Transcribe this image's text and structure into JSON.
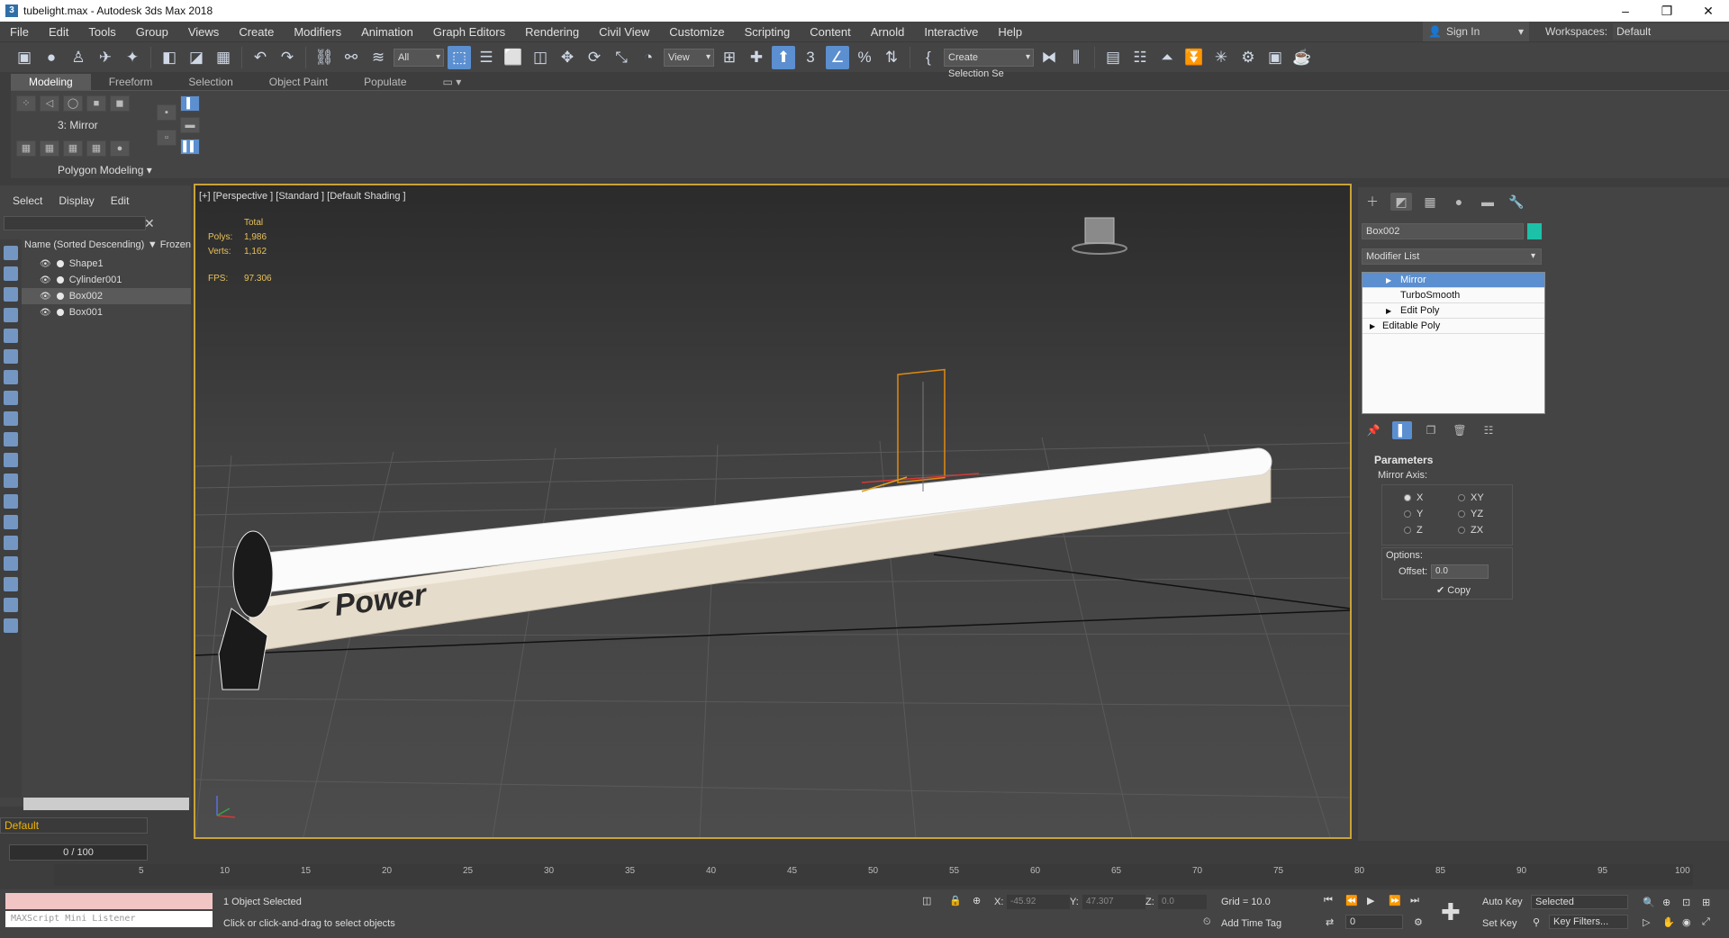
{
  "window": {
    "title": "tubelight.max - Autodesk 3ds Max 2018",
    "app_icon": "3",
    "minimize_glyph": "–",
    "restore_glyph": "❐",
    "close_glyph": "✕"
  },
  "menus": [
    "File",
    "Edit",
    "Tools",
    "Group",
    "Views",
    "Create",
    "Modifiers",
    "Animation",
    "Graph Editors",
    "Rendering",
    "Civil View",
    "Customize",
    "Scripting",
    "Content",
    "Arnold",
    "Interactive",
    "Help"
  ],
  "account": {
    "sign_in": "Sign In",
    "workspaces_label": "Workspaces:",
    "workspace_value": "Default"
  },
  "toolbar": {
    "filter_select": "All",
    "view_select": "View",
    "selection_set": "Create Selection Se",
    "icons": [
      "undo-icon",
      "redo-icon",
      "link-icon",
      "unlink-icon",
      "bind-spacewarp-icon"
    ]
  },
  "ribbon": {
    "tabs": [
      "Modeling",
      "Freeform",
      "Selection",
      "Object Paint",
      "Populate"
    ],
    "active_tab": "Modeling",
    "modifier_label": "3: Mirror",
    "panel_label": "Polygon Modeling ▾"
  },
  "explorer": {
    "tabs": [
      "Select",
      "Display",
      "Edit"
    ],
    "column_name": "Name (Sorted Descending)",
    "column_frozen": "▼ Frozen",
    "objects": [
      {
        "name": "Shape1",
        "selected": false
      },
      {
        "name": "Cylinder001",
        "selected": false
      },
      {
        "name": "Box002",
        "selected": true
      },
      {
        "name": "Box001",
        "selected": false
      }
    ],
    "layer": "Default"
  },
  "viewport": {
    "label": "[+] [Perspective ] [Standard ] [Default Shading ]",
    "stats_total": "Total",
    "polys_label": "Polys:",
    "polys_value": "1,986",
    "verts_label": "Verts:",
    "verts_value": "1,162",
    "fps_label": "FPS:",
    "fps_value": "97.306",
    "brand_text": "Power"
  },
  "command_panel": {
    "object_name": "Box002",
    "object_color": "#1cc1a8",
    "modifier_list": "Modifier List",
    "stack": [
      {
        "label": "Mirror",
        "selected": true
      },
      {
        "label": "TurboSmooth",
        "selected": false
      },
      {
        "label": "Edit Poly",
        "selected": false
      },
      {
        "label": "Editable Poly",
        "selected": false
      }
    ],
    "params": {
      "title": "Parameters",
      "mirror_axis": "Mirror Axis:",
      "axes": [
        "X",
        "Y",
        "Z",
        "XY",
        "YZ",
        "ZX"
      ],
      "selected_axis": "X",
      "options": "Options:",
      "offset_label": "Offset:",
      "offset_value": "0.0",
      "copy_label": "Copy"
    }
  },
  "timeline": {
    "slider": "0 / 100",
    "ticks": [
      "5",
      "10",
      "15",
      "20",
      "25",
      "30",
      "35",
      "40",
      "45",
      "50",
      "55",
      "60",
      "65",
      "70",
      "75",
      "80",
      "85",
      "90",
      "95",
      "100"
    ]
  },
  "status": {
    "maxscript": "MAXScript Mini Listener",
    "selected": "1 Object Selected",
    "prompt": "Click or click-and-drag to select objects",
    "x_label": "X:",
    "x_value": "-45.92",
    "y_label": "Y:",
    "y_value": "47.307",
    "z_label": "Z:",
    "z_value": "0.0",
    "grid": "Grid = 10.0",
    "add_time_tag": "Add Time Tag",
    "auto_key": "Auto Key",
    "set_key": "Set Key",
    "key_mode": "Selected",
    "key_filters": "Key Filters...",
    "frame_value": "0"
  },
  "colors": {
    "viewport_border": "#c9a23a",
    "accent": "#5b8fd0",
    "stats": "#e8c25a"
  }
}
